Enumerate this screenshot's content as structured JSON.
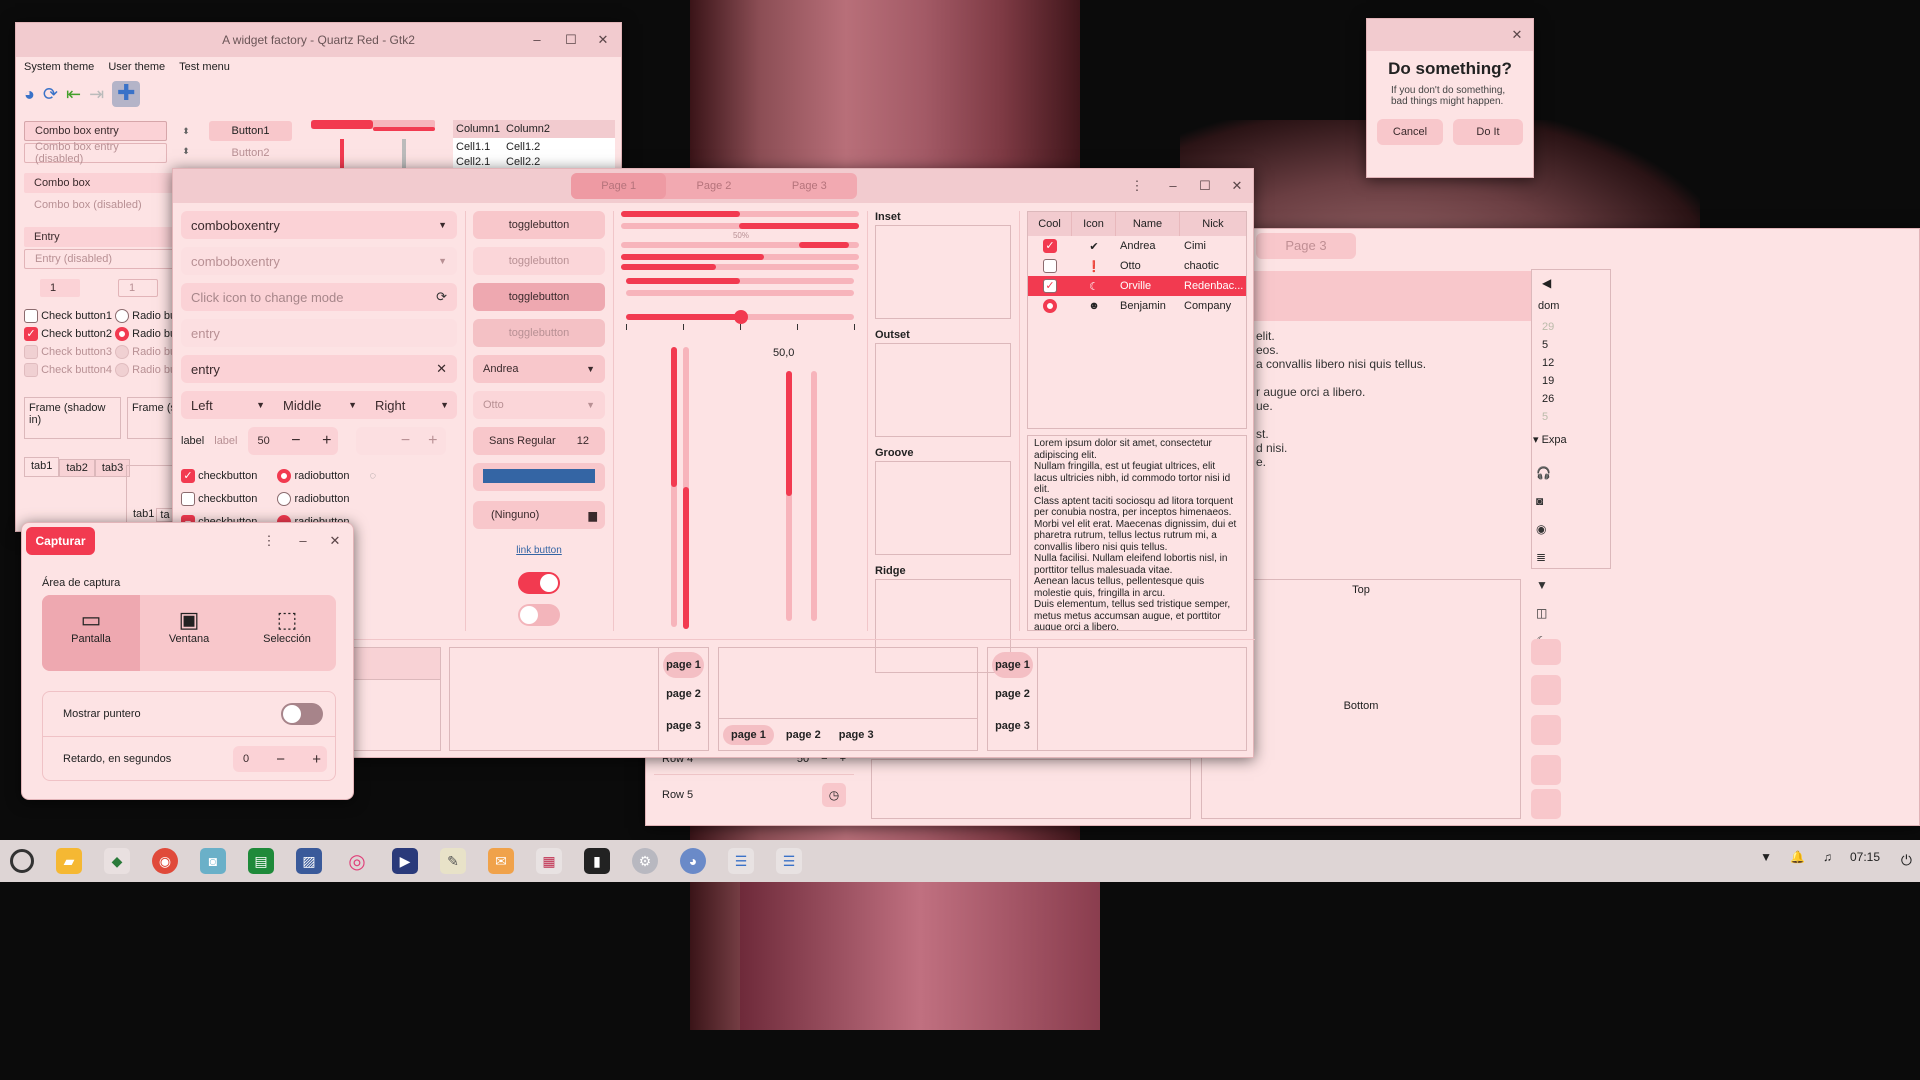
{
  "win1": {
    "title": "A widget factory - Quartz Red - Gtk2",
    "menu": [
      "System theme",
      "User theme",
      "Test menu"
    ],
    "combo_entry": "Combo box entry",
    "combo_entry_dis": "Combo box entry (disabled)",
    "combo": "Combo box",
    "combo_dis": "Combo box (disabled)",
    "entry": "Entry",
    "entry_dis": "Entry (disabled)",
    "spin1": "1",
    "spin2": "1",
    "checks": [
      "Check button1",
      "Check button2",
      "Check button3",
      "Check button4"
    ],
    "radios": [
      "Radio butt",
      "Radio butt",
      "Radio butt",
      "Radio butt"
    ],
    "button1": "Button1",
    "button2": "Button2",
    "tree_cols": [
      "Column1",
      "Column2"
    ],
    "tree_rows": [
      [
        "Cell1.1",
        "Cell1.2"
      ],
      [
        "Cell2.1",
        "Cell2.2"
      ]
    ],
    "frame1": "Frame (shadow in)",
    "frame2": "Frame (sh",
    "tabs": [
      "tab1",
      "tab2",
      "tab3"
    ],
    "tabs2": [
      "tab1",
      "ta"
    ]
  },
  "dialog": {
    "title": "Do something?",
    "message": "If you don't do something, bad things might happen.",
    "cancel": "Cancel",
    "ok": "Do It"
  },
  "main": {
    "tabs": [
      "Page 1",
      "Page 2",
      "Page 3"
    ],
    "col1": {
      "combo1": "comboboxentry",
      "combo2": "comboboxentry",
      "click_icon": "Click icon to change mode",
      "entry_placeholder": "entry",
      "entry_value": "entry",
      "drops": [
        "Left",
        "Middle",
        "Right"
      ],
      "label1": "label",
      "label2": "label",
      "spin_value": "50",
      "checks": [
        "checkbutton",
        "checkbutton",
        "checkbutton"
      ],
      "radios": [
        "radiobutton",
        "radiobutton",
        "radiobutton"
      ]
    },
    "col2": {
      "toggles": [
        "togglebutton",
        "togglebutton",
        "togglebutton",
        "togglebutton"
      ],
      "combo_andrea": "Andrea",
      "combo_otto": "Otto",
      "font_name": "Sans Regular",
      "font_size": "12",
      "file": "(Ninguno)",
      "link": "link button",
      "switch1_on": true,
      "switch2_on": false
    },
    "col3": {
      "progress_label": "50%",
      "scale_value": "50,0",
      "progress_top": 0.5
    },
    "frames": [
      "Inset",
      "Outset",
      "Groove",
      "Ridge"
    ],
    "tree": {
      "cols": [
        "Cool",
        "Icon",
        "Name",
        "Nick"
      ],
      "rows": [
        {
          "cool": true,
          "icon": "check-circle-icon",
          "name": "Andrea",
          "nick": "Cimi"
        },
        {
          "cool": false,
          "icon": "alert-icon",
          "name": "Otto",
          "nick": "chaotic"
        },
        {
          "cool": true,
          "icon": "moon-icon",
          "name": "Orville",
          "nick": "Redenbac..."
        },
        {
          "cool": "radio",
          "icon": "face-icon",
          "name": "Benjamin",
          "nick": "Company"
        }
      ]
    },
    "lorem": "Lorem ipsum dolor sit amet, consectetur adipiscing elit.\nNullam fringilla, est ut feugiat ultrices, elit lacus ultricies nibh, id commodo tortor nisi id elit.\nClass aptent taciti sociosqu ad litora torquent per conubia nostra, per inceptos himenaeos.\nMorbi vel elit erat. Maecenas dignissim, dui et pharetra rutrum, tellus lectus rutrum mi, a convallis libero nisi quis tellus.\nNulla facilisi. Nullam eleifend lobortis nisl, in porttitor tellus malesuada vitae.\nAenean lacus tellus, pellentesque quis molestie quis, fringilla in arcu.\nDuis elementum, tellus sed tristique semper, metus metus accumsan augue, et porttitor augue orci a libero.",
    "nb_pages": [
      "page 1",
      "page 2",
      "page 3"
    ]
  },
  "capture": {
    "button": "Capturar",
    "area": "Área de captura",
    "modes": [
      "Pantalla",
      "Ventana",
      "Selección"
    ],
    "pointer": "Mostrar puntero",
    "delay": "Retardo, en segundos",
    "delay_value": "0"
  },
  "back": {
    "tab": "Page 3",
    "text_lines": [
      "elit.",
      "eos.",
      "a convallis libero nisi quis tellus.",
      "",
      "r augue orci a libero.",
      "ue.",
      "",
      "st.",
      "d nisi.",
      "e."
    ],
    "cal_header": "dom",
    "cal_days": [
      "29",
      "5",
      "12",
      "19",
      "26",
      "5"
    ],
    "expander": "Expa",
    "top": "Top",
    "bottom": "Bottom",
    "row4": "Row 4",
    "row4_val": "50",
    "row5": "Row 5"
  },
  "clock": "07:15"
}
